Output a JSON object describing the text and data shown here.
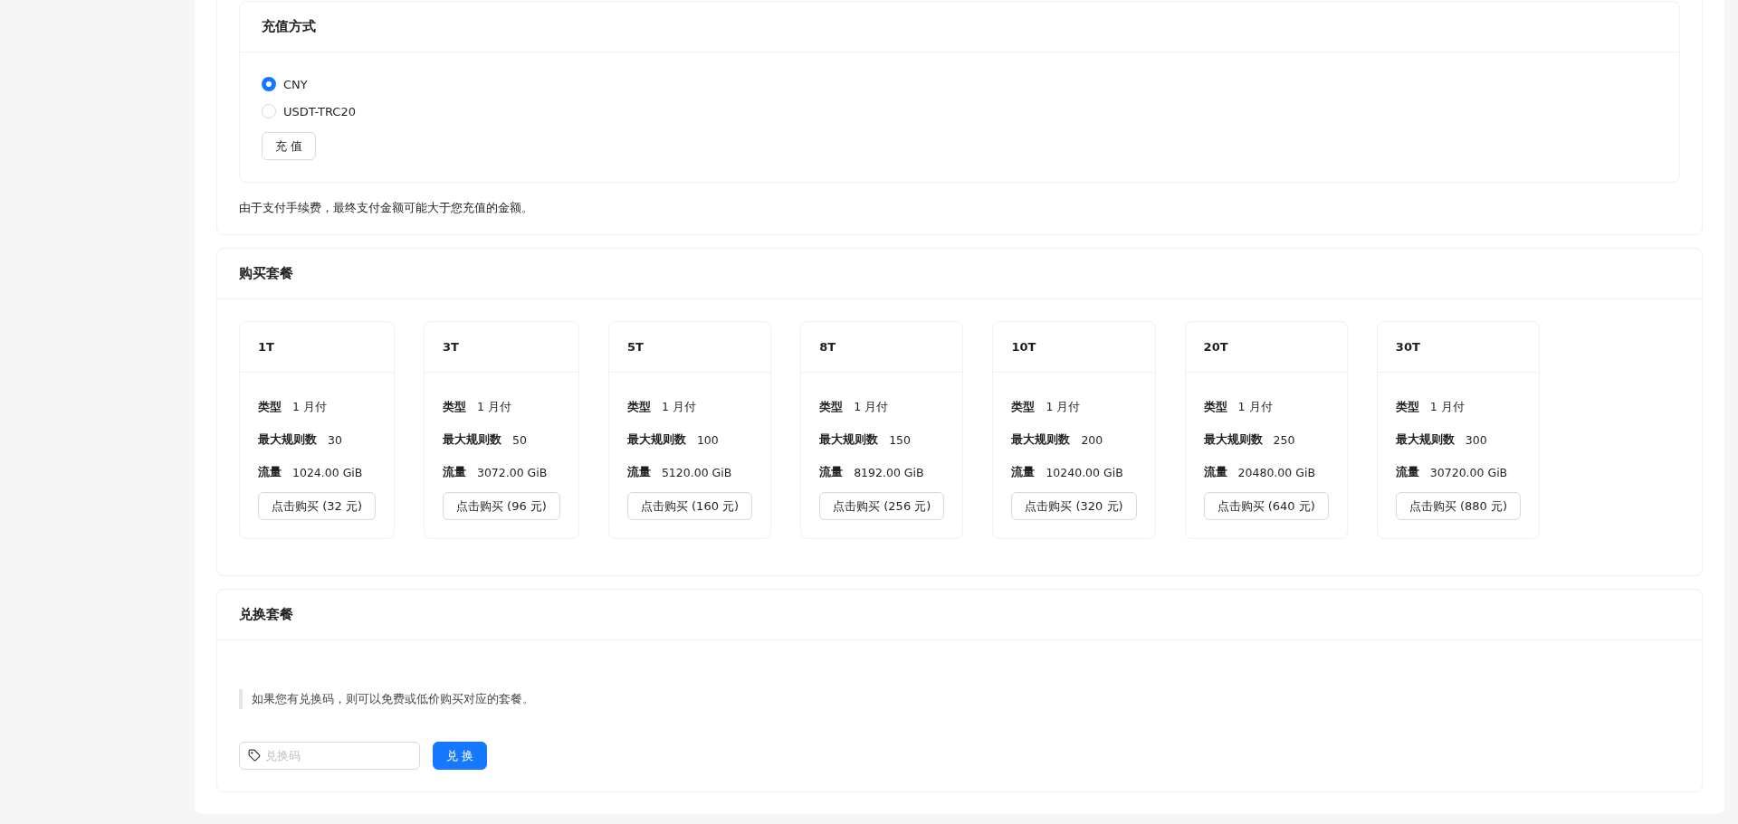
{
  "recharge": {
    "title": "充值方式",
    "options": [
      {
        "label": "CNY",
        "selected": true
      },
      {
        "label": "USDT-TRC20",
        "selected": false
      }
    ],
    "button": "充 值",
    "note": "由于支付手续费，最终支付金额可能大于您充值的金额。"
  },
  "packages": {
    "title": "购买套餐",
    "items": [
      {
        "name": "1T",
        "fields": [
          {
            "label": "类型",
            "value": "1 月付"
          },
          {
            "label": "最大规则数",
            "value": "30"
          },
          {
            "label": "流量",
            "value": "1024.00 GiB"
          }
        ],
        "button": "点击购买 (32 元)"
      },
      {
        "name": "3T",
        "fields": [
          {
            "label": "类型",
            "value": "1 月付"
          },
          {
            "label": "最大规则数",
            "value": "50"
          },
          {
            "label": "流量",
            "value": "3072.00 GiB"
          }
        ],
        "button": "点击购买 (96 元)"
      },
      {
        "name": "5T",
        "fields": [
          {
            "label": "类型",
            "value": "1 月付"
          },
          {
            "label": "最大规则数",
            "value": "100"
          },
          {
            "label": "流量",
            "value": "5120.00 GiB"
          }
        ],
        "button": "点击购买 (160 元)"
      },
      {
        "name": "8T",
        "fields": [
          {
            "label": "类型",
            "value": "1 月付"
          },
          {
            "label": "最大规则数",
            "value": "150"
          },
          {
            "label": "流量",
            "value": "8192.00 GiB"
          }
        ],
        "button": "点击购买 (256 元)"
      },
      {
        "name": "10T",
        "fields": [
          {
            "label": "类型",
            "value": "1 月付"
          },
          {
            "label": "最大规则数",
            "value": "200"
          },
          {
            "label": "流量",
            "value": "10240.00 GiB"
          }
        ],
        "button": "点击购买 (320 元)"
      },
      {
        "name": "20T",
        "fields": [
          {
            "label": "类型",
            "value": "1 月付"
          },
          {
            "label": "最大规则数",
            "value": "250"
          },
          {
            "label": "流量",
            "value": "20480.00 GiB"
          }
        ],
        "button": "点击购买 (640 元)"
      },
      {
        "name": "30T",
        "fields": [
          {
            "label": "类型",
            "value": "1 月付"
          },
          {
            "label": "最大规则数",
            "value": "300"
          },
          {
            "label": "流量",
            "value": "30720.00 GiB"
          }
        ],
        "button": "点击购买 (880 元)"
      }
    ]
  },
  "redeem": {
    "title": "兑换套餐",
    "notice": "如果您有兑换码，则可以免费或低价购买对应的套餐。",
    "input": {
      "placeholder": "兑换码"
    },
    "button": "兑 换"
  }
}
